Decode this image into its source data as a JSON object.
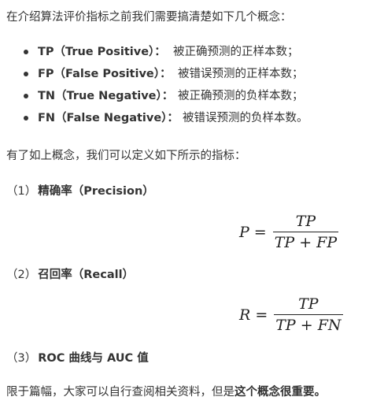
{
  "intro": "在介绍算法评价指标之前我们需要搞清楚如下几个概念：",
  "definitions": [
    {
      "term": "TP（True Positive）：",
      "desc": "被正确预测的正样本数；"
    },
    {
      "term": "FP（False Positive）：",
      "desc": "被错误预测的正样本数；"
    },
    {
      "term": "TN（True Negative）：",
      "desc": "被正确预测的负样本数；"
    },
    {
      "term": "FN（False Negative）：",
      "desc": "被错误预测的负样本数。"
    }
  ],
  "after_text": "有了如上概念，我们可以定义如下所示的指标：",
  "sections": [
    {
      "num": "（1）",
      "title": "精确率（Precision）"
    },
    {
      "num": "（2）",
      "title": "召回率（Recall）"
    },
    {
      "num": "（3）",
      "title": "ROC 曲线与 AUC 值"
    }
  ],
  "formulas": [
    {
      "lhs": "P",
      "eq": "=",
      "numerator": "TP",
      "denominator": "TP + FP"
    },
    {
      "lhs": "R",
      "eq": "=",
      "numerator": "TP",
      "denominator": "TP + FN"
    }
  ],
  "closing": {
    "text": "限于篇幅，大家可以自行查阅相关资料，但是",
    "bold": "这个概念很重要。"
  }
}
